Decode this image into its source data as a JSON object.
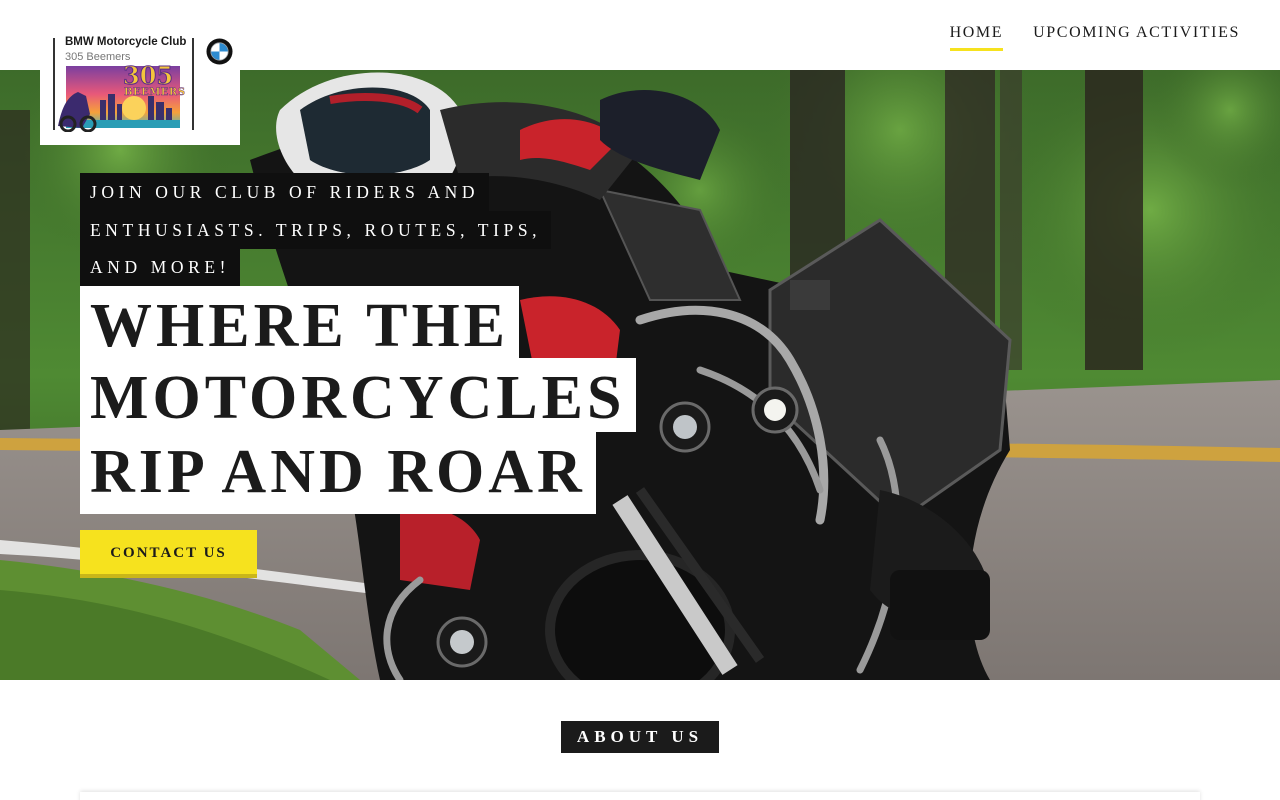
{
  "logo": {
    "line1": "BMW Motorcycle Club",
    "line2": "305 Beemers",
    "emblem_text": "305",
    "emblem_subtext": "BEEMERS"
  },
  "nav": {
    "items": [
      {
        "label": "HOME",
        "active": true
      },
      {
        "label": "UPCOMING ACTIVITIES",
        "active": false
      }
    ]
  },
  "hero": {
    "tagline_lines": [
      "JOIN OUR CLUB OF RIDERS AND",
      "ENTHUSIASTS.  TRIPS, ROUTES, TIPS,",
      "AND MORE!"
    ],
    "headline_lines": [
      "WHERE THE",
      "MOTORCYCLES",
      "RIP AND ROAR"
    ],
    "cta_label": "CONTACT US"
  },
  "about": {
    "label": "ABOUT US"
  },
  "colors": {
    "accent": "#f6e21e",
    "dark": "#1b1b1b",
    "tagline_bg": "#0f0f0f"
  }
}
